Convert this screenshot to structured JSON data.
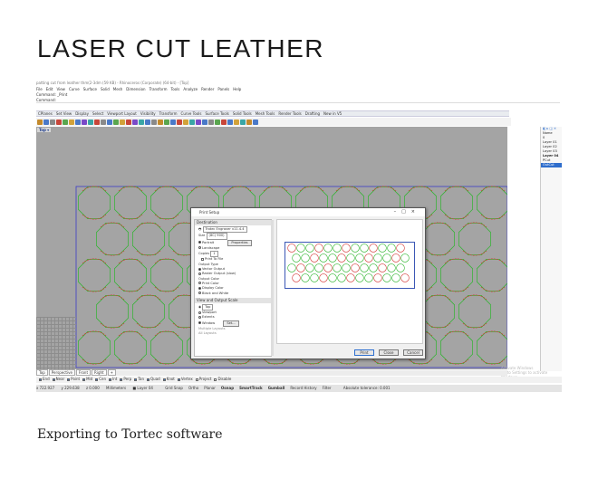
{
  "page": {
    "title": "LASER CUT LEATHER",
    "caption": "Exporting to Tortec software"
  },
  "app": {
    "window_title": "patting cut from leather thm(2-3dm (59 KB) - Rhinoceros (Corporate) (64-bit) - [Top]",
    "menu": [
      "File",
      "Edit",
      "View",
      "Curve",
      "Surface",
      "Solid",
      "Mesh",
      "Dimension",
      "Transform",
      "Tools",
      "Analyze",
      "Render",
      "Panels",
      "Help"
    ],
    "command": "Command: _Print",
    "command_prompt": "Command:",
    "toolbar_tabs": [
      "CPlanes",
      "Set View",
      "Display",
      "Select",
      "Viewport Layout",
      "Visibility",
      "Transform",
      "Curve Tools",
      "Surface Tools",
      "Solid Tools",
      "Mesh Tools",
      "Render Tools",
      "Drafting",
      "New in V5"
    ],
    "viewport_label": "Top",
    "viewport_tabs": [
      "Top",
      "Perspective",
      "Front",
      "Right",
      "+"
    ],
    "osnaps": [
      {
        "label": "End",
        "on": true
      },
      {
        "label": "Near",
        "on": true
      },
      {
        "label": "Point",
        "on": true
      },
      {
        "label": "Mid",
        "on": true
      },
      {
        "label": "Cen",
        "on": true
      },
      {
        "label": "Int",
        "on": true
      },
      {
        "label": "Perp",
        "on": true
      },
      {
        "label": "Tan",
        "on": true
      },
      {
        "label": "Quad",
        "on": true
      },
      {
        "label": "Knot",
        "on": true
      },
      {
        "label": "Vertex",
        "on": true
      },
      {
        "label": "Project",
        "on": false
      },
      {
        "label": "Disable",
        "on": false
      }
    ],
    "status": {
      "x": "x 722.927",
      "y": "y 229.638",
      "z": "z 0.000",
      "units": "Millimeters",
      "layer": "Layer 04",
      "toggles": [
        "Grid Snap",
        "Ortho",
        "Planar",
        "Osnap",
        "SmartTrack",
        "Gumball",
        "Record History",
        "Filter"
      ],
      "bold_toggles": [
        "Osnap",
        "SmartTrack",
        "Gumball"
      ],
      "tolerance": "Absolute tolerance: 0.001"
    },
    "layers_panel": {
      "header": "Name",
      "layers": [
        "0",
        "Layer 01",
        "Layer 02",
        "Layer 03",
        "Layer 04",
        "PCut",
        "OutCut"
      ],
      "bold": "Layer 04",
      "selected": "OutCut"
    },
    "watermark": [
      "Activate Windows",
      "Go to Settings to activate Windows."
    ]
  },
  "print_dialog": {
    "title": "Print Setup",
    "destination_header": "Destination",
    "printer": "Trotec Engraver v11.4.4",
    "size_label": "Size",
    "size_value": "(8C) 900)",
    "properties_button": "Properties",
    "orientation": [
      {
        "label": "Portrait",
        "on": true
      },
      {
        "label": "Landscape",
        "on": false
      }
    ],
    "copies_label": "Copies",
    "copies_value": "1",
    "print_to_file": "Print To File",
    "output_type_header": "Output Type",
    "output_type": [
      {
        "label": "Vector Output",
        "on": true
      },
      {
        "label": "Raster Output (slow)",
        "on": false
      }
    ],
    "output_color_header": "Output Color",
    "output_color": [
      {
        "label": "Print Color",
        "on": false
      },
      {
        "label": "Display Color",
        "on": true
      },
      {
        "label": "Black and White",
        "on": false
      }
    ],
    "view_header": "View and Output Scale",
    "view_value": "Top",
    "view_options": [
      {
        "label": "Viewport",
        "on": false
      },
      {
        "label": "Extents",
        "on": false
      },
      {
        "label": "Window",
        "on": true
      }
    ],
    "set_button": "Set...",
    "multiple_layouts": "Multiple Layouts",
    "all_layouts": "All Layouts",
    "buttons": {
      "print": "Print",
      "close": "Close",
      "cancel": "Cancel"
    },
    "window_controls": [
      "–",
      "□",
      "×"
    ]
  },
  "colors": {
    "viewport_bg": "#a4a4a4",
    "cut_green": "#2fb52f",
    "cut_red": "#d43636",
    "boundary_blue": "#3b3bc8",
    "selection_blue": "#2f6ecc"
  }
}
